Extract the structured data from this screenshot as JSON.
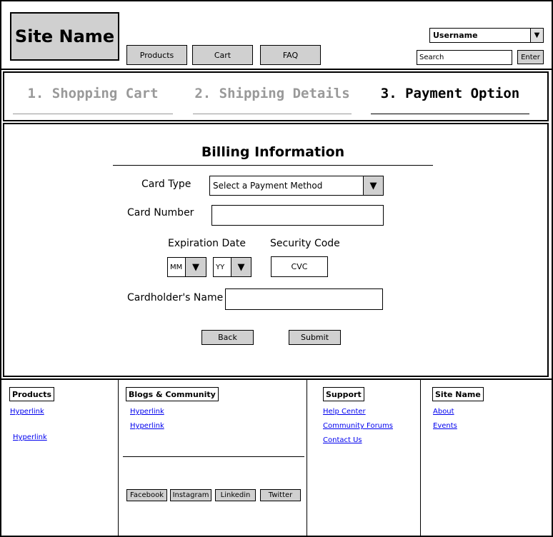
{
  "header": {
    "site_name": "Site Name",
    "nav": [
      "Products",
      "Cart",
      "FAQ"
    ],
    "user_select": "Username",
    "search_placeholder": "Search",
    "enter_label": "Enter"
  },
  "steps": [
    {
      "label": "1. Shopping Cart",
      "active": false
    },
    {
      "label": "2. Shipping Details",
      "active": false
    },
    {
      "label": "3. Payment Option",
      "active": true
    }
  ],
  "billing": {
    "title": "Billing Information",
    "card_type_label": "Card Type",
    "card_type_value": "Select a Payment Method",
    "card_number_label": "Card Number",
    "card_number_value": "",
    "expiration_label": "Expiration Date",
    "month_value": "MM",
    "year_value": "YY",
    "security_label": "Security Code",
    "security_placeholder": "CVC",
    "cardholder_label": "Cardholder's Name",
    "cardholder_value": "",
    "back_label": "Back",
    "submit_label": "Submit"
  },
  "footer": {
    "products": {
      "title": "Products",
      "links": [
        "Hyperlink",
        "Hyperlink"
      ]
    },
    "community": {
      "title": "Blogs & Community",
      "links": [
        "Hyperlink",
        "Hyperlink"
      ],
      "social": [
        "Facebook",
        "Instagram",
        "Linkedin",
        "Twitter"
      ]
    },
    "support": {
      "title": "Support",
      "links": [
        "Help Center",
        "Community Forums",
        "Contact Us"
      ]
    },
    "site": {
      "title": "Site Name",
      "links": [
        "About",
        "Events"
      ]
    }
  },
  "icons": {
    "dropdown_arrow": "▼"
  }
}
